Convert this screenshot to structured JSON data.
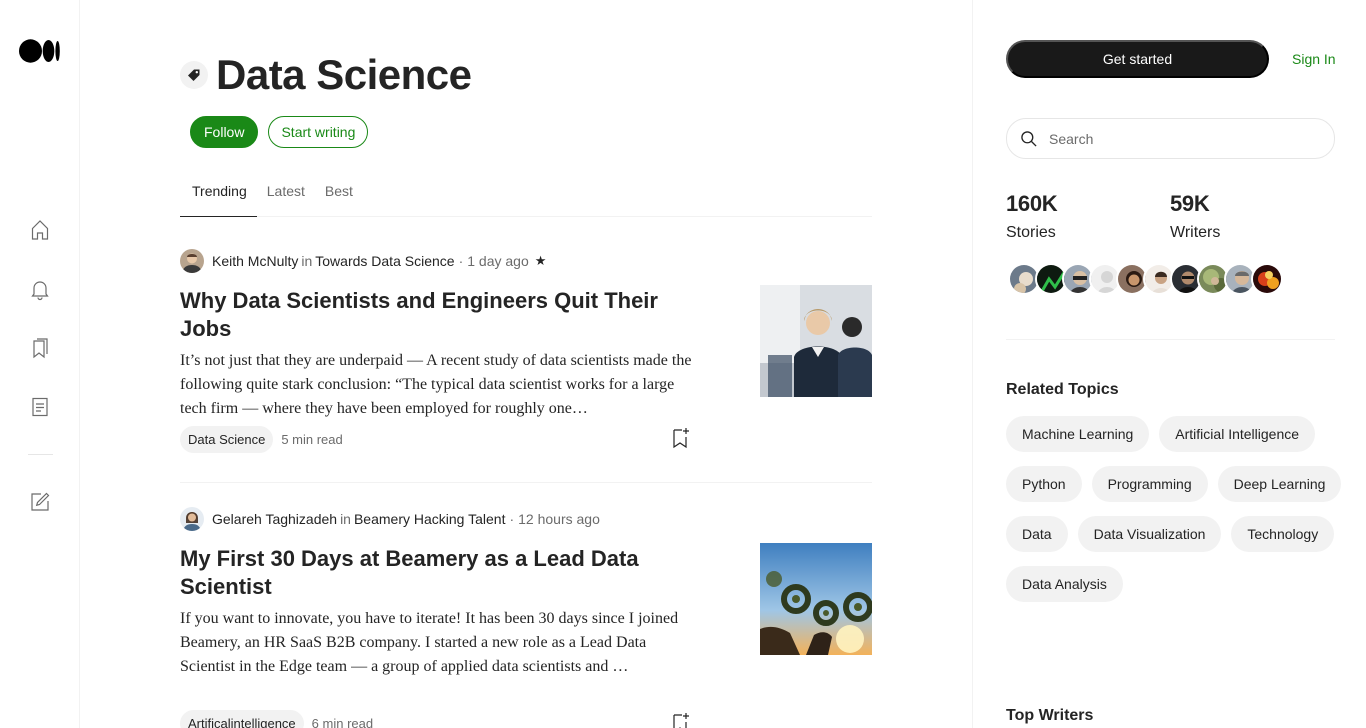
{
  "topic": {
    "title": "Data Science",
    "follow_label": "Follow",
    "write_label": "Start writing"
  },
  "tabs": [
    {
      "label": "Trending",
      "active": true
    },
    {
      "label": "Latest",
      "active": false
    },
    {
      "label": "Best",
      "active": false
    }
  ],
  "articles": [
    {
      "author": "Keith McNulty",
      "in": "in",
      "publication": "Towards Data Science",
      "time": "1 day ago",
      "member_star": "★",
      "title": "Why Data Scientists and Engineers Quit Their Jobs",
      "description": "It’s not just that they are underpaid — A recent study of data scientists made the following quite stark conclusion: “The typical data scientist works for a large tech firm — where they have been employed for roughly one…",
      "tag": "Data Science",
      "read_time": "5 min read"
    },
    {
      "author": "Gelareh Taghizadeh",
      "in": "in",
      "publication": "Beamery Hacking Talent",
      "time": "12 hours ago",
      "title": "My First 30 Days at Beamery as a Lead Data Scientist",
      "description": "If you want to innovate, you have to iterate! It has been 30 days since I joined Beamery, an HR SaaS B2B company. I started a new role as a Lead Data Scientist in the Edge team — a group of applied data scientists and …",
      "tag": "Artificalintelligence",
      "read_time": "6 min read"
    }
  ],
  "sidebar": {
    "get_started_label": "Get started",
    "sign_in_label": "Sign In",
    "search_placeholder": "Search",
    "stats": [
      {
        "value": "160K",
        "label": "Stories"
      },
      {
        "value": "59K",
        "label": "Writers"
      }
    ],
    "related_title": "Related Topics",
    "related_topics": [
      "Machine Learning",
      "Artificial Intelligence",
      "Python",
      "Programming",
      "Deep Learning",
      "Data",
      "Data Visualization",
      "Technology",
      "Data Analysis"
    ],
    "top_writers_title": "Top Writers"
  },
  "colors": {
    "accent_green": "#1a8917",
    "text": "#242424",
    "muted": "#6b6b6b",
    "pill_bg": "#f2f2f2",
    "dark_button": "#191919"
  },
  "icons": {
    "logo": "medium-logo-icon",
    "rail": [
      "home-icon",
      "bell-icon",
      "bookmarks-icon",
      "stories-icon",
      "write-icon"
    ],
    "topic": "tag-icon",
    "search": "search-icon",
    "save": "bookmark-add-icon"
  }
}
